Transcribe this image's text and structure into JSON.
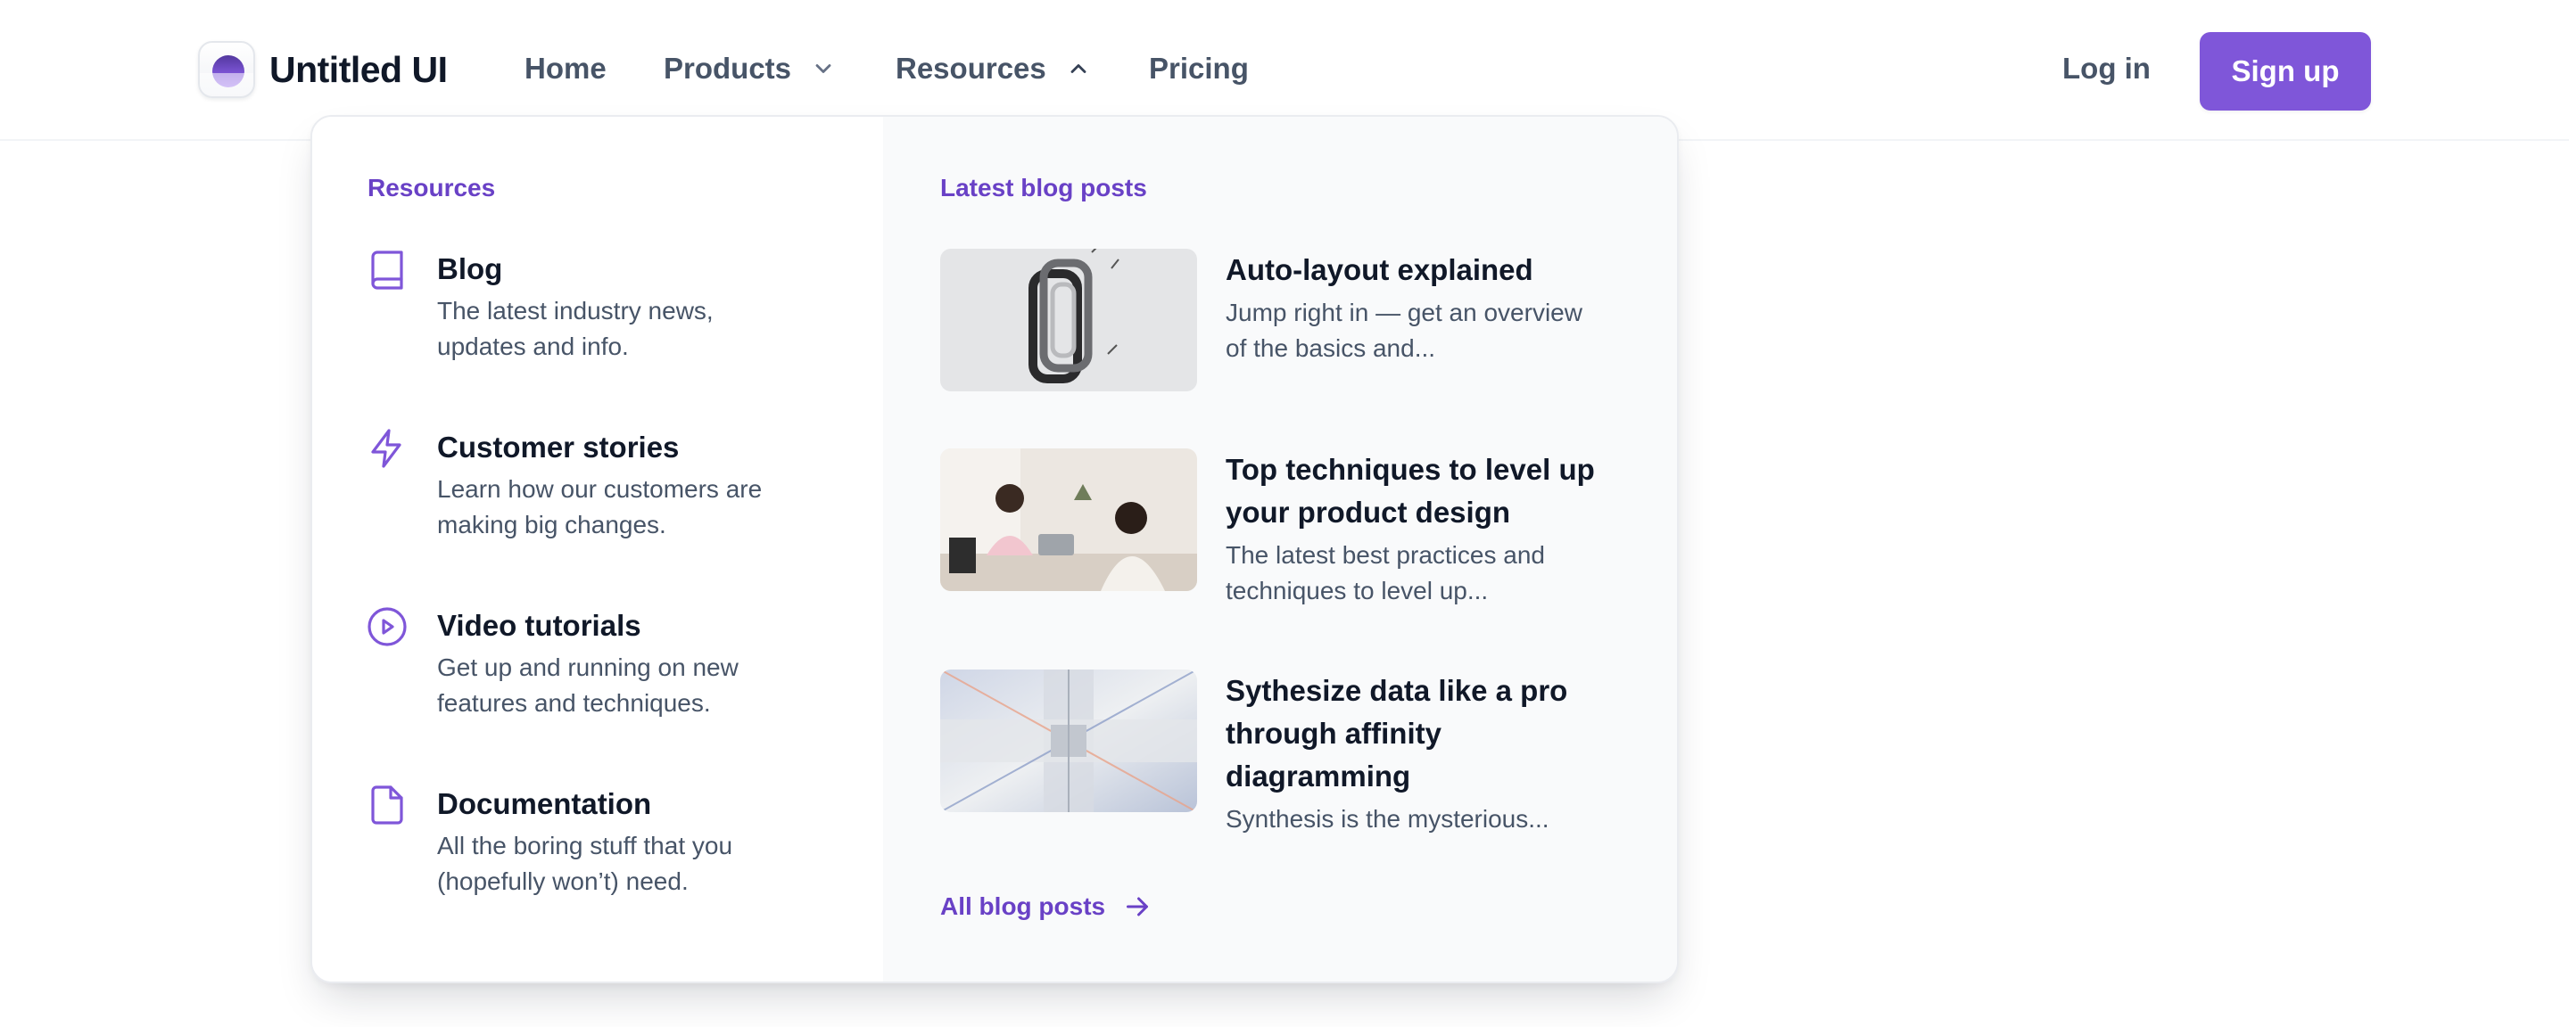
{
  "header": {
    "brand": "Untitled UI",
    "nav": {
      "home": "Home",
      "products": "Products",
      "resources": "Resources",
      "pricing": "Pricing"
    },
    "login_label": "Log in",
    "signup_label": "Sign up"
  },
  "dropdown": {
    "resources_title": "Resources",
    "resources": [
      {
        "title": "Blog",
        "desc_line1": "The latest industry news,",
        "desc_line2": "updates and info.",
        "icon": "book-icon"
      },
      {
        "title": "Customer stories",
        "desc_line1": "Learn how our customers are",
        "desc_line2": "making big changes.",
        "icon": "lightning-icon"
      },
      {
        "title": "Video tutorials",
        "desc_line1": "Get up and running on new",
        "desc_line2": "features and techniques.",
        "icon": "play-circle-icon"
      },
      {
        "title": "Documentation",
        "desc_line1": "All the boring stuff that you",
        "desc_line2": "(hopefully won’t) need.",
        "icon": "file-icon"
      }
    ],
    "blog_title": "Latest blog posts",
    "posts": [
      {
        "title_line1": "Auto-layout explained",
        "desc_line1": "Jump right in — get an overview",
        "desc_line2": "of the basics and..."
      },
      {
        "title_line1": "Top techniques to level up",
        "title_line2": "your product design",
        "desc_line1": "The latest best practices and",
        "desc_line2": "techniques to level up..."
      },
      {
        "title_line1": "Sythesize data like a pro",
        "title_line2": "through affinity",
        "title_line3": "diagramming",
        "desc_line1": "Synthesis is the mysterious..."
      }
    ],
    "all_posts_label": "All blog posts"
  },
  "colors": {
    "accent": "#7f56d9",
    "accent_text": "#6941c6",
    "heading": "#101828",
    "body": "#475467",
    "panel_bg": "#f9fafb"
  }
}
